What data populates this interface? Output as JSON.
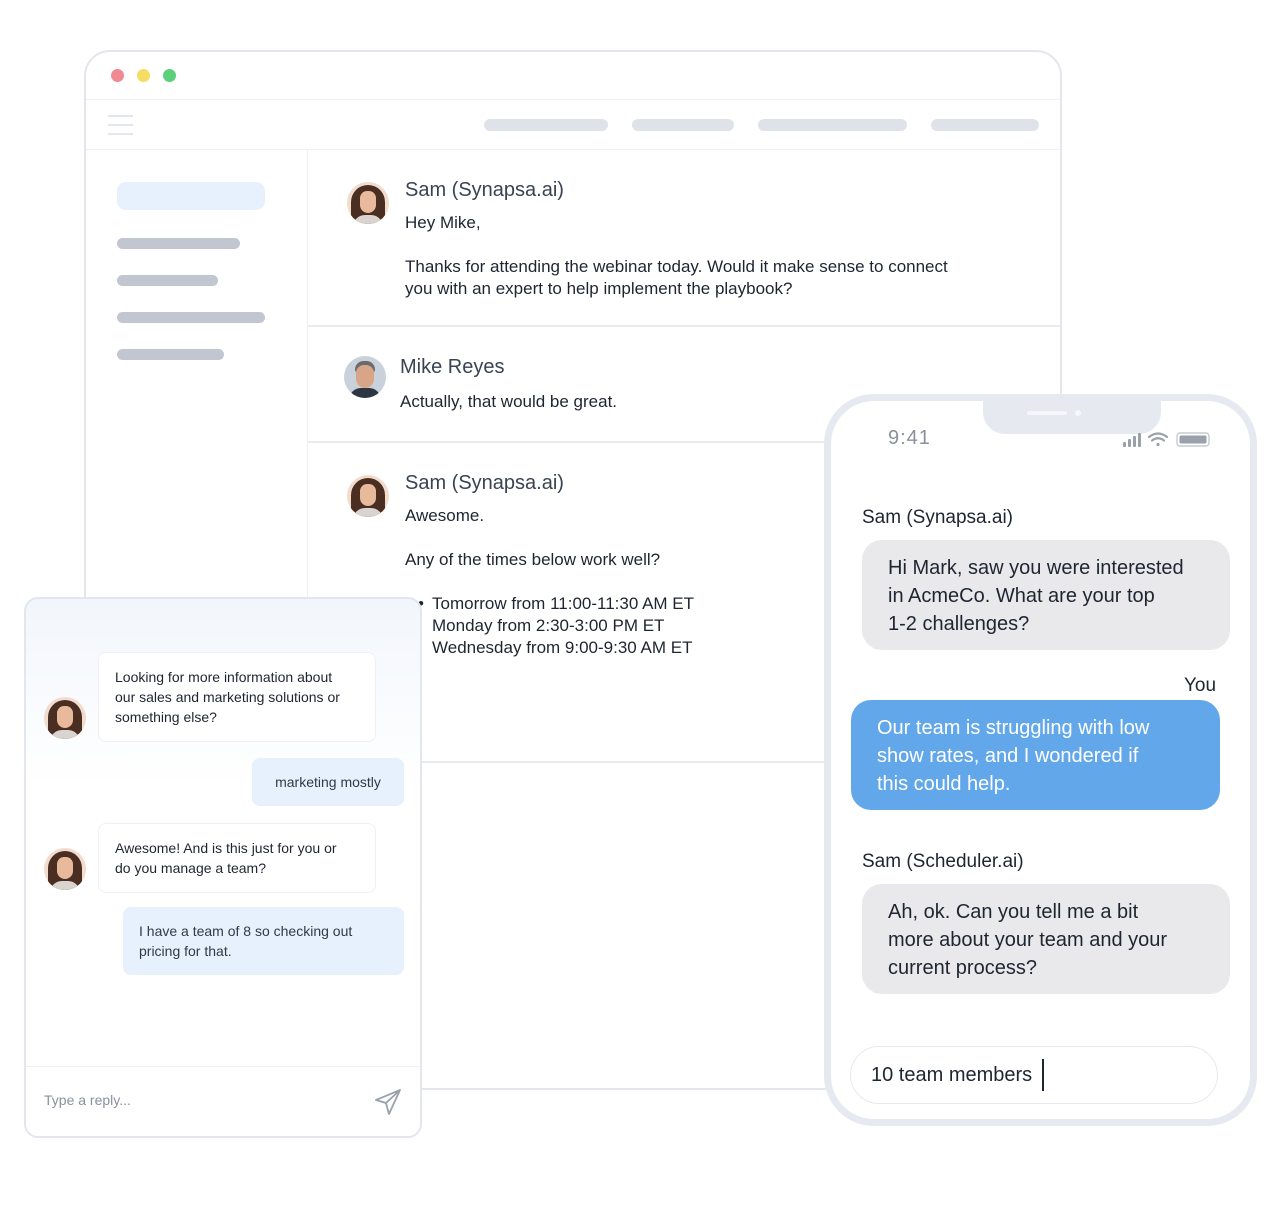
{
  "browser": {
    "thread": [
      {
        "author": "Sam (Synapsa.ai)",
        "greeting": "Hey Mike,",
        "body_line1": "Thanks for attending the webinar today.  Would it make sense to connect",
        "body_line2": "you with an expert to help implement the playbook?"
      },
      {
        "author": "Mike Reyes",
        "body": "Actually, that would be great."
      },
      {
        "author": "Sam (Synapsa.ai)",
        "greeting": "Awesome.",
        "question": "Any of the times below work well?",
        "options": [
          "Tomorrow from 11:00-11:30 AM ET",
          "Monday from 2:30-3:00 PM ET",
          "Wednesday from 9:00-9:30 AM ET"
        ]
      }
    ]
  },
  "widget": {
    "messages": [
      {
        "from": "bot",
        "text_line1": "Looking for more information about",
        "text_line2": "our sales and marketing solutions or",
        "text_line3": "something else?"
      },
      {
        "from": "user",
        "text": "marketing mostly"
      },
      {
        "from": "bot",
        "text_line1": "Awesome! And is this just for you or",
        "text_line2": "do you manage a team?"
      },
      {
        "from": "user",
        "text_line1": "I have a team of 8 so checking out",
        "text_line2": "pricing for that."
      }
    ],
    "reply_placeholder": "Type a reply...",
    "send_icon": "paper-plane-icon"
  },
  "phone": {
    "time": "9:41",
    "status_icons": [
      "signal-icon",
      "wifi-icon",
      "battery-icon"
    ],
    "bot_name_1": "Sam (Synapsa.ai)",
    "bot_msg_1_line1": "Hi Mark, saw you were interested",
    "bot_msg_1_line2": "in AcmeCo. What are your top",
    "bot_msg_1_line3": "1-2 challenges?",
    "me_label": "You",
    "me_msg_line1": "Our team is struggling with low",
    "me_msg_line2": "show rates, and I wondered if",
    "me_msg_line3": "this could help.",
    "bot_name_2": "Sam (Scheduler.ai)",
    "bot_msg_2_line1": "Ah, ok. Can you tell me a bit",
    "bot_msg_2_line2": "more about your team and your",
    "bot_msg_2_line3": "current process?",
    "input_value": "10 team members"
  },
  "colors": {
    "accent_blue": "#62a7ea",
    "bubble_light_blue": "#e7f0fd",
    "bot_bubble_gray": "#e9e9ec",
    "window_dot_red": "#f08a92",
    "window_dot_yellow": "#f7dc62",
    "window_dot_green": "#5ccf7a"
  }
}
